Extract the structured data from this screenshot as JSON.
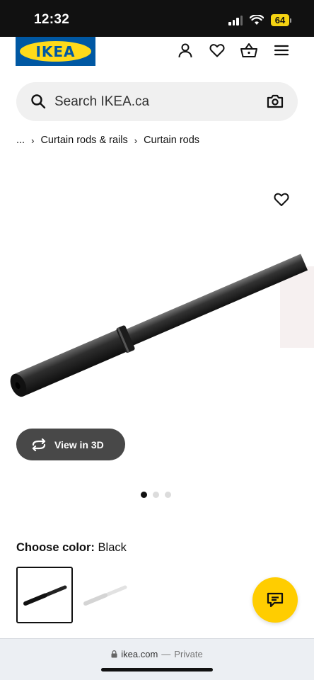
{
  "status_bar": {
    "time": "12:32",
    "battery": "64"
  },
  "header": {
    "logo_text": "IKEA",
    "icons": [
      "user-icon",
      "heart-icon",
      "basket-icon",
      "menu-icon"
    ]
  },
  "search": {
    "placeholder": "Search IKEA.ca"
  },
  "breadcrumb": {
    "ellipsis": "...",
    "items": [
      "Curtain rods & rails",
      "Curtain rods"
    ]
  },
  "gallery": {
    "view_3d_label": "View in 3D",
    "image_count": 3,
    "active_index": 0
  },
  "color": {
    "label": "Choose color:",
    "value": "Black",
    "options": [
      "black",
      "white"
    ]
  },
  "browser": {
    "domain": "ikea.com",
    "separator": "—",
    "mode": "Private"
  },
  "colors": {
    "ikea_blue": "#0058a3",
    "ikea_yellow": "#ffda1a",
    "chat_yellow": "#ffcd00",
    "battery": "#f5d312"
  }
}
